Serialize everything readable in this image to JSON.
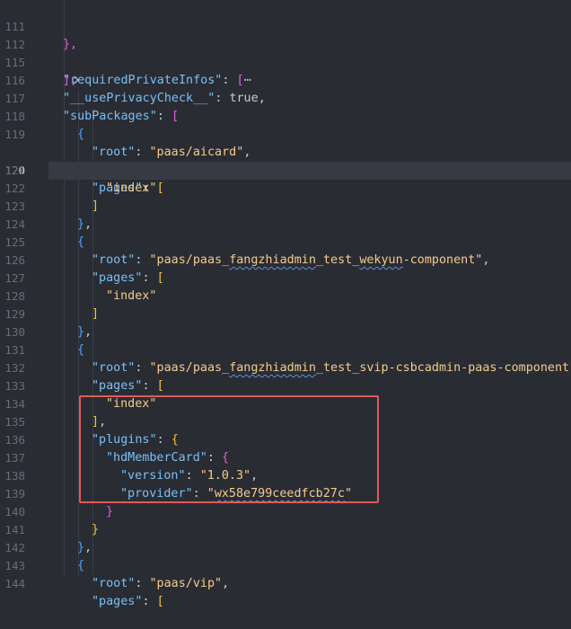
{
  "editor": {
    "gutter": {
      "line_numbers": [
        "111",
        "112",
        "115",
        "116",
        "117",
        "118",
        "119",
        "120",
        "121",
        "122",
        "123",
        "124",
        "125",
        "126",
        "127",
        "128",
        "129",
        "130",
        "131",
        "132",
        "133",
        "134",
        "135",
        "136",
        "137",
        "138",
        "139",
        "140",
        "141",
        "142",
        "143",
        "144"
      ],
      "active_line": "120",
      "fold_icon": "chevron-right"
    },
    "lines": {
      "l111": {
        "p": "},"
      },
      "l112": {
        "key": "\"requiredPrivateInfos\"",
        "colon": ": ",
        "bracket": "[",
        "ellipsis": "⋯"
      },
      "l115": {
        "p": "],"
      },
      "l116": {
        "key": "\"__usePrivacyCheck__\"",
        "colon": ": ",
        "value": "true",
        "comma": ","
      },
      "l117": {
        "key": "\"subPackages\"",
        "colon": ": ",
        "bracket": "["
      },
      "l118": {
        "bracket": "{"
      },
      "l119": {
        "key": "\"root\"",
        "colon": ": ",
        "value": "\"paas/aicard\"",
        "comma": ","
      },
      "l120": {
        "key": "\"pages\"",
        "colon": ": ",
        "bracket": "["
      },
      "l121": {
        "value": "\"index\""
      },
      "l122": {
        "bracket": "]"
      },
      "l123": {
        "bracket": "}",
        "comma": ","
      },
      "l124": {
        "bracket": "{"
      },
      "l125": {
        "key": "\"root\"",
        "colon": ": ",
        "value_pre": "\"paas/paas_",
        "value_squig": "fangzhiadmin",
        "value_mid": "_test_",
        "value_squig2": "wekyun",
        "value_post": "-component\"",
        "comma": ","
      },
      "l126": {
        "key": "\"pages\"",
        "colon": ": ",
        "bracket": "["
      },
      "l127": {
        "value": "\"index\""
      },
      "l128": {
        "bracket": "]"
      },
      "l129": {
        "bracket": "}",
        "comma": ","
      },
      "l130": {
        "bracket": "{"
      },
      "l131": {
        "key": "\"root\"",
        "colon": ": ",
        "value_pre": "\"paas/paas_",
        "value_squig": "fangzhiadmin",
        "value_mid": "_test_",
        "value_squig2": "svip",
        "value_post": "-csbcadmin-paas-component\"",
        "comma": ","
      },
      "l132": {
        "key": "\"pages\"",
        "colon": ": ",
        "bracket": "["
      },
      "l133": {
        "value": "\"index\""
      },
      "l134": {
        "bracket": "]",
        "comma": ","
      },
      "l135": {
        "key": "\"plugins\"",
        "colon": ": ",
        "bracket": "{"
      },
      "l136": {
        "key": "\"hdMemberCard\"",
        "colon": ": ",
        "bracket": "{"
      },
      "l137": {
        "key": "\"version\"",
        "colon": ": ",
        "value": "\"1.0.3\"",
        "comma": ","
      },
      "l138": {
        "key": "\"provider\"",
        "colon": ": ",
        "value_pre": "\"",
        "value_squig": "wx58e799ceedfcb27c",
        "value_post": "\""
      },
      "l139": {
        "bracket": "}"
      },
      "l140": {
        "bracket": "}"
      },
      "l141": {
        "bracket": "}",
        "comma": ","
      },
      "l142": {
        "bracket": "{"
      },
      "l143": {
        "key": "\"root\"",
        "colon": ": ",
        "value": "\"paas/vip\"",
        "comma": ","
      },
      "l144": {
        "key": "\"pages\"",
        "colon": ": ",
        "bracket": "["
      }
    }
  },
  "colors": {
    "background": "#2a2c34",
    "key": "#79c0f5",
    "string": "#f3cc8b",
    "bracket_yellow": "#f2c33a",
    "bracket_magenta": "#db62d6",
    "bracket_blue": "#4ba3ff",
    "highlight_box": "#e25a58"
  }
}
